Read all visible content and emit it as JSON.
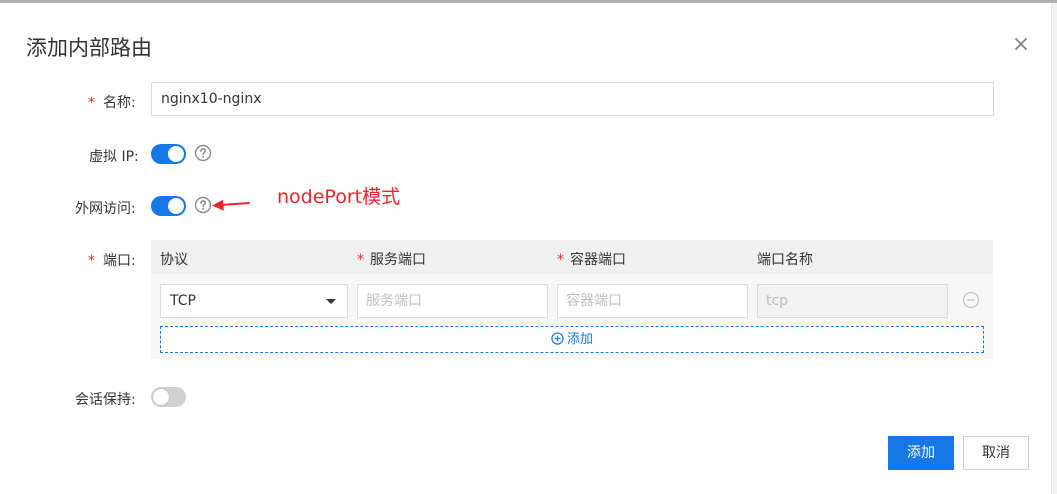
{
  "dialog": {
    "title": "添加内部路由",
    "close_symbol": "×"
  },
  "form": {
    "name": {
      "label": "名称:",
      "required_mark": "*",
      "value": "nginx10-nginx"
    },
    "virtual_ip": {
      "label": "虚拟 IP:",
      "enabled": true
    },
    "external_access": {
      "label": "外网访问:",
      "enabled": true
    },
    "annotation": "nodePort模式",
    "ports": {
      "label": "端口:",
      "required_mark": "*",
      "columns": [
        {
          "label": "协议",
          "required": false
        },
        {
          "label": "服务端口",
          "required": true
        },
        {
          "label": "容器端口",
          "required": true
        },
        {
          "label": "端口名称",
          "required": false
        }
      ],
      "rows": [
        {
          "protocol": "TCP",
          "service_port_placeholder": "服务端口",
          "container_port_placeholder": "容器端口",
          "port_name_value": "tcp"
        }
      ],
      "add_label": "添加"
    },
    "session_affinity": {
      "label": "会话保持:",
      "enabled": false
    }
  },
  "buttons": {
    "confirm": "添加",
    "cancel": "取消"
  },
  "colors": {
    "primary": "#1677e6",
    "required": "#f5222d",
    "annotation": "#e8262a"
  },
  "icons": {
    "help": "question-circle-icon",
    "remove": "minus-circle-icon",
    "add": "plus-circle-icon",
    "close": "close-icon",
    "caret": "caret-down-icon",
    "arrow": "red-arrow-icon"
  }
}
